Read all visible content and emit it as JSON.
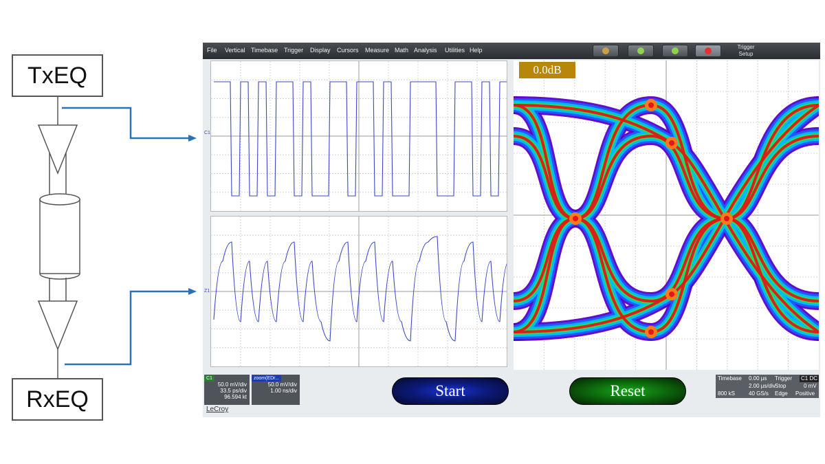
{
  "diagram": {
    "tx_label": "TxEQ",
    "rx_label": "RxEQ"
  },
  "menu": {
    "items": [
      "File",
      "Vertical",
      "Timebase",
      "Trigger",
      "Display",
      "Cursors",
      "Measure",
      "Math",
      "Analysis",
      "Utilities",
      "Help"
    ],
    "trigger_setup": [
      "Trigger",
      "Setup"
    ]
  },
  "channel_markers": [
    "C1",
    "Z1"
  ],
  "eye": {
    "db_label": "0.0dB",
    "colors": [
      "#5a00c8",
      "#1f5cff",
      "#00bfff",
      "#2bdc55",
      "#f2ee2a",
      "#ff7a1a",
      "#e01818"
    ]
  },
  "readouts": {
    "c1": {
      "tag": "C1",
      "lines": [
        "50.0 mV/div",
        "33.5 ps/div",
        "96.594 kt"
      ]
    },
    "z1": {
      "tag": "zoom(EDr...",
      "lines": [
        "50.0 mV/div",
        "1.00 ns/div"
      ]
    }
  },
  "buttons": {
    "start": "Start",
    "reset": "Reset"
  },
  "timebase": {
    "timebase_label": "Timebase",
    "timebase_value": "0.00 µs",
    "trigger_label": "Trigger",
    "trigger_tag": "C1 DC",
    "row2_left": "",
    "time_div": "2.00 µs/div",
    "stop": "Stop",
    "trig_level": "0 mV",
    "samples": "800 kS",
    "rate": "40 GS/s",
    "edge": "Edge",
    "slope": "Positive"
  },
  "brand": "LeCroy",
  "colors": {
    "trace": "#3a48c8",
    "arrow": "#2a72b5"
  }
}
